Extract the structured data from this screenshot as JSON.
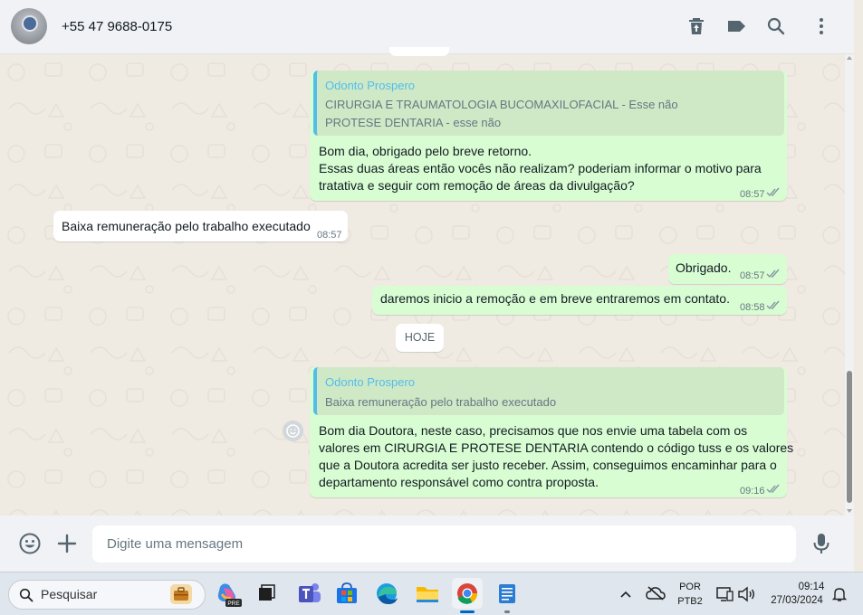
{
  "header": {
    "contact_name": "+55 47 9688-0175",
    "icons": [
      "delete-chat-icon",
      "label-icon",
      "search-icon",
      "menu-icon"
    ]
  },
  "messages": [
    {
      "direction": "out",
      "quote_author": "Odonto Prospero",
      "quote_lines": [
        "CIRURGIA E TRAUMATOLOGIA BUCOMAXILOFACIAL - Esse não",
        "PROTESE DENTARIA - esse não"
      ],
      "lines": [
        "Bom dia, obrigado pelo breve retorno.",
        "Essas duas áreas então vocês não realizam? poderiam informar o motivo para",
        "tratativa e seguir com remoção de áreas da divulgação?"
      ],
      "time": "08:57",
      "status": "read"
    },
    {
      "direction": "in",
      "lines": [
        "Baixa remuneração pelo trabalho executado"
      ],
      "time": "08:57"
    },
    {
      "direction": "out",
      "lines": [
        "Obrigado."
      ],
      "time": "08:57",
      "status": "read"
    },
    {
      "direction": "out",
      "lines": [
        "daremos inicio a remoção e em breve entraremos em contato."
      ],
      "time": "08:58",
      "status": "read"
    },
    {
      "direction": "out",
      "quote_author": "Odonto Prospero",
      "quote_lines": [
        "Baixa remuneração pelo trabalho executado"
      ],
      "lines": [
        "Bom dia Doutora, neste caso, precisamos que nos envie uma tabela com os",
        "valores em CIRURGIA E PROTESE DENTARIA contendo o código tuss e os valores",
        "que a Doutora acredita ser justo receber. Assim, conseguimos encaminhar para o",
        "departamento responsável como contra proposta."
      ],
      "time": "09:16",
      "status": "read"
    }
  ],
  "date_divider": "HOJE",
  "composer": {
    "placeholder": "Digite uma mensagem",
    "icons": [
      "emoji-icon",
      "attach-plus-icon",
      "microphone-icon"
    ]
  },
  "taskbar": {
    "search_label": "Pesquisar",
    "apps": [
      "work-briefcase-icon",
      "copilot-icon",
      "task-view-icon",
      "teams-icon",
      "microsoft-store-icon",
      "edge-icon",
      "file-explorer-icon",
      "chrome-icon",
      "notepad-icon"
    ],
    "copilot_badge": "PRE",
    "language_line1": "POR",
    "language_line2": "PTB2",
    "clock_time": "09:14",
    "clock_date": "27/03/2024"
  },
  "colors": {
    "outgoing_bubble": "#d9fdd3",
    "incoming_bubble": "#ffffff",
    "chat_background": "#efeae2",
    "quote_accent": "#53bdeb",
    "read_ticks": "#8696a0"
  }
}
